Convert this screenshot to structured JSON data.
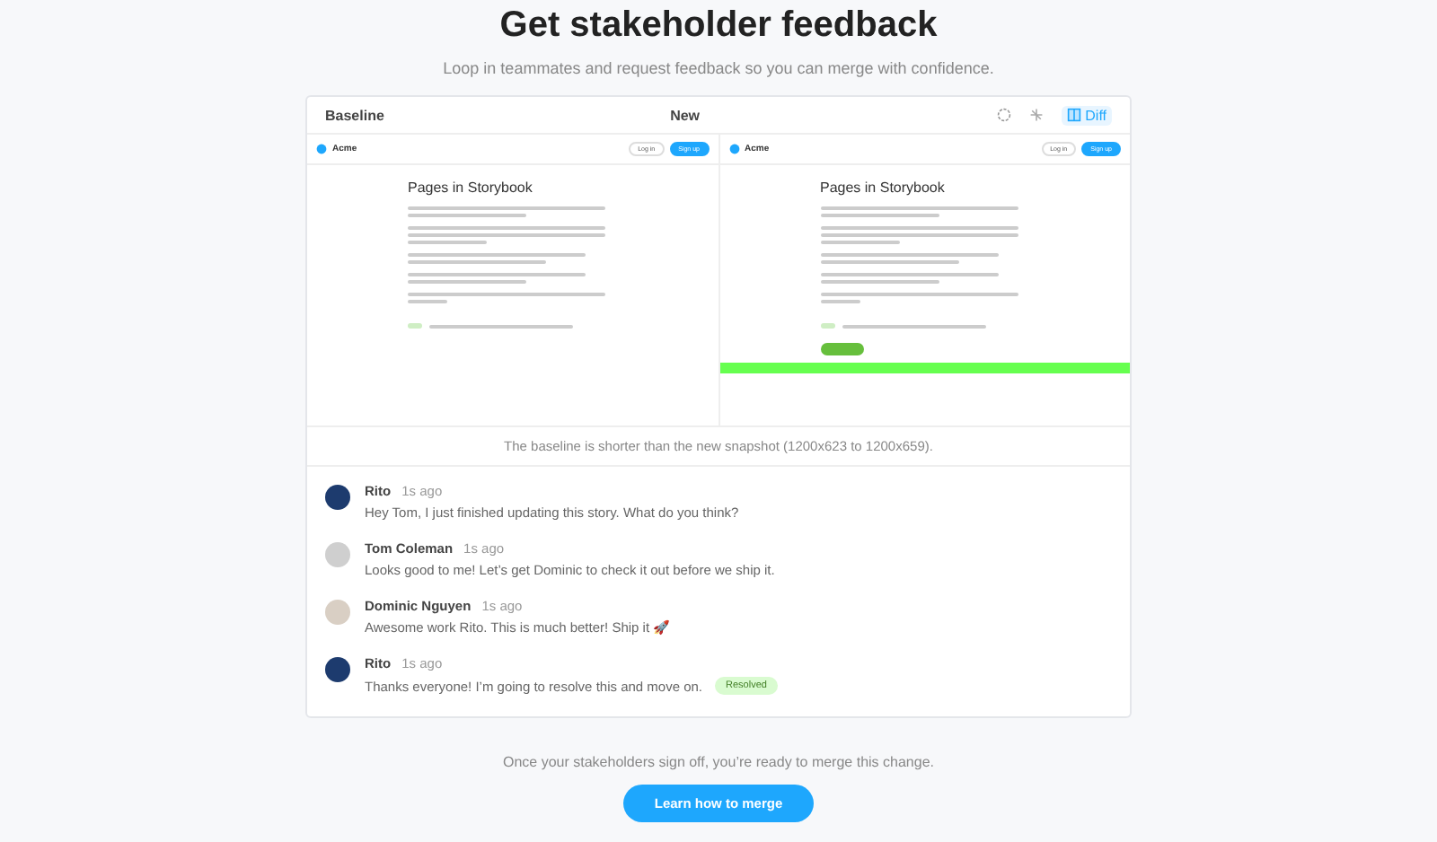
{
  "heading": "Get stakeholder feedback",
  "subheading": "Loop in teammates and request feedback so you can merge with confidence.",
  "toolbar": {
    "diff": {
      "label": "Diff",
      "selected": true
    }
  },
  "snapshots": [
    {
      "label": "Baseline",
      "brand": "Acme",
      "login": "Log in",
      "signup": "Sign up",
      "title": "Pages in Storybook",
      "extra_button": false,
      "diff_highlight": false
    },
    {
      "label": "New",
      "brand": "Acme",
      "login": "Log in",
      "signup": "Sign up",
      "title": "Pages in Storybook",
      "extra_button": true,
      "diff_highlight": true
    }
  ],
  "caption": "The baseline is shorter than the new snapshot (1200x623 to 1200x659).",
  "comments": [
    {
      "author": "Rito",
      "time": "1s ago",
      "text": "Hey Tom, I just finished updating this story. What do you think?",
      "color": "#1d3b6e"
    },
    {
      "author": "Tom Coleman",
      "time": "1s ago",
      "text": "Looks good to me! Let’s get Dominic to check it out before we ship it.",
      "color": "#cfcfcf"
    },
    {
      "author": "Dominic Nguyen",
      "time": "1s ago",
      "text": "Awesome work Rito. This is much better! Ship it 🚀",
      "color": "#d9cfc4"
    },
    {
      "author": "Rito",
      "time": "1s ago",
      "text": "Thanks everyone! I’m going to resolve this and move on.",
      "color": "#1d3b6e",
      "badge": "Resolved"
    }
  ],
  "footer": "Once your stakeholders sign off, you’re ready to merge this change.",
  "cta": "Learn how to merge"
}
